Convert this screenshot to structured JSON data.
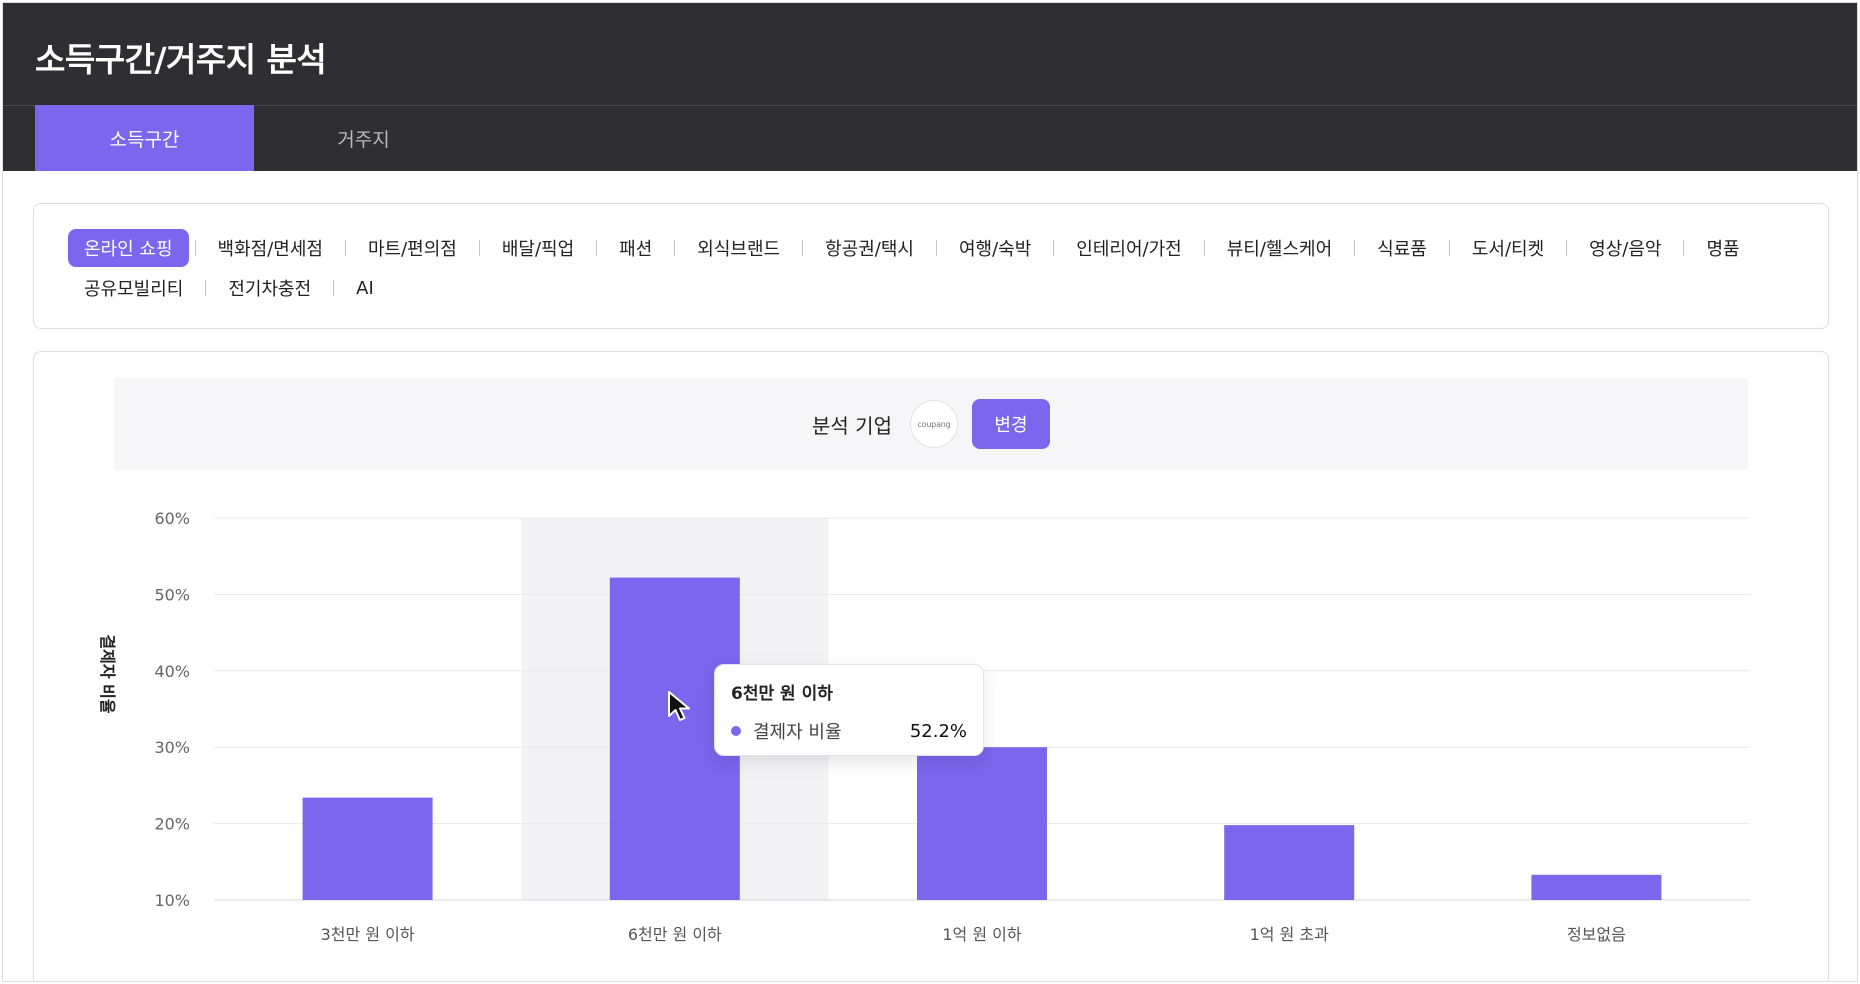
{
  "header": {
    "title": "소득구간/거주지 분석",
    "tabs": [
      {
        "label": "소득구간",
        "active": true
      },
      {
        "label": "거주지",
        "active": false
      }
    ]
  },
  "categories": {
    "row1": [
      "온라인 쇼핑",
      "백화점/면세점",
      "마트/편의점",
      "배달/픽업",
      "패션",
      "외식브랜드",
      "항공권/택시",
      "여행/숙박",
      "인테리어/가전",
      "뷰티/헬스케어",
      "식료품",
      "도서/티켓",
      "영상/음악",
      "명품"
    ],
    "row2": [
      "공유모빌리티",
      "전기차충전",
      "AI"
    ],
    "selected": "온라인 쇼핑"
  },
  "company": {
    "label": "분석 기업",
    "logo_text": "coupang",
    "change_label": "변경"
  },
  "chart_data": {
    "type": "bar",
    "categories": [
      "3천만 원 이하",
      "6천만 원 이하",
      "1억 원 이하",
      "1억 원 초과",
      "정보없음"
    ],
    "values": [
      23.4,
      52.2,
      30.0,
      19.8,
      13.3
    ],
    "ylabel": "결제자 비율",
    "yticks": [
      "10%",
      "20%",
      "30%",
      "40%",
      "50%",
      "60%"
    ],
    "ylim": [
      10,
      60
    ],
    "grid": true,
    "highlighted_category": "6천만 원 이하",
    "bar_color": "#7b66ed"
  },
  "tooltip": {
    "title": "6천만 원 이하",
    "series": "결제자 비율",
    "value": "52.2%"
  },
  "colors": {
    "accent": "#7b66ed",
    "header_bg": "#2f2f33"
  }
}
